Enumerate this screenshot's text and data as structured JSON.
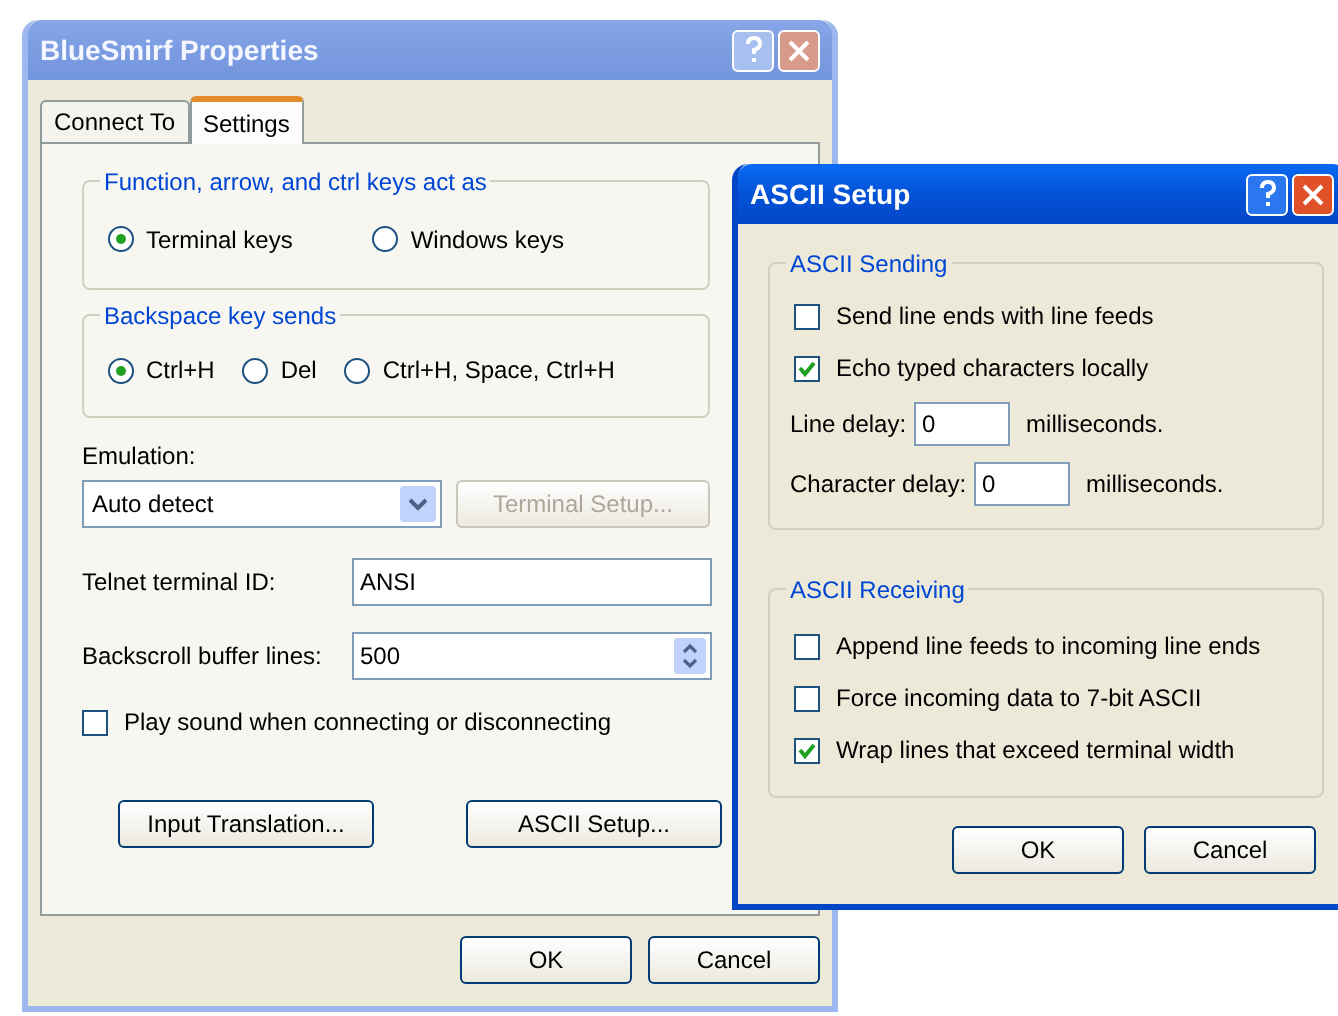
{
  "properties_window": {
    "title": "BlueSmirf Properties",
    "active": false,
    "tabs": [
      {
        "label": "Connect To",
        "selected": false
      },
      {
        "label": "Settings",
        "selected": true
      }
    ],
    "key_group": {
      "label": "Function, arrow, and ctrl keys act as",
      "options": [
        {
          "label": "Terminal keys",
          "selected": true
        },
        {
          "label": "Windows keys",
          "selected": false
        }
      ]
    },
    "backspace_group": {
      "label": "Backspace key sends",
      "options": [
        {
          "label": "Ctrl+H",
          "selected": true
        },
        {
          "label": "Del",
          "selected": false
        },
        {
          "label": "Ctrl+H, Space, Ctrl+H",
          "selected": false
        }
      ]
    },
    "emulation": {
      "label": "Emulation:",
      "value": "Auto detect"
    },
    "terminal_setup_button": {
      "label": "Terminal Setup...",
      "disabled": true
    },
    "telnet_id": {
      "label": "Telnet terminal ID:",
      "value": "ANSI"
    },
    "backscroll": {
      "label": "Backscroll buffer lines:",
      "value": "500"
    },
    "play_sound": {
      "label": "Play sound when connecting or disconnecting",
      "checked": false
    },
    "buttons": [
      "Input Translation...",
      "ASCII Setup..."
    ],
    "footer_buttons": [
      "OK",
      "Cancel"
    ]
  },
  "ascii_setup_dialog": {
    "title": "ASCII Setup",
    "active": true,
    "sending": {
      "label": "ASCII Sending",
      "checkboxes": [
        {
          "label": "Send line ends with line feeds",
          "checked": false
        },
        {
          "label": "Echo typed characters locally",
          "checked": true
        }
      ],
      "delays": [
        {
          "label": "Line delay:",
          "value": "0",
          "unit": "milliseconds."
        },
        {
          "label": "Character delay:",
          "value": "0",
          "unit": "milliseconds."
        }
      ]
    },
    "receiving": {
      "label": "ASCII Receiving",
      "checkboxes": [
        {
          "label": "Append line feeds to incoming line ends",
          "checked": false
        },
        {
          "label": "Force incoming data to 7-bit ASCII",
          "checked": false
        },
        {
          "label": "Wrap lines that exceed terminal width",
          "checked": true
        }
      ]
    },
    "buttons": [
      "OK",
      "Cancel"
    ]
  }
}
